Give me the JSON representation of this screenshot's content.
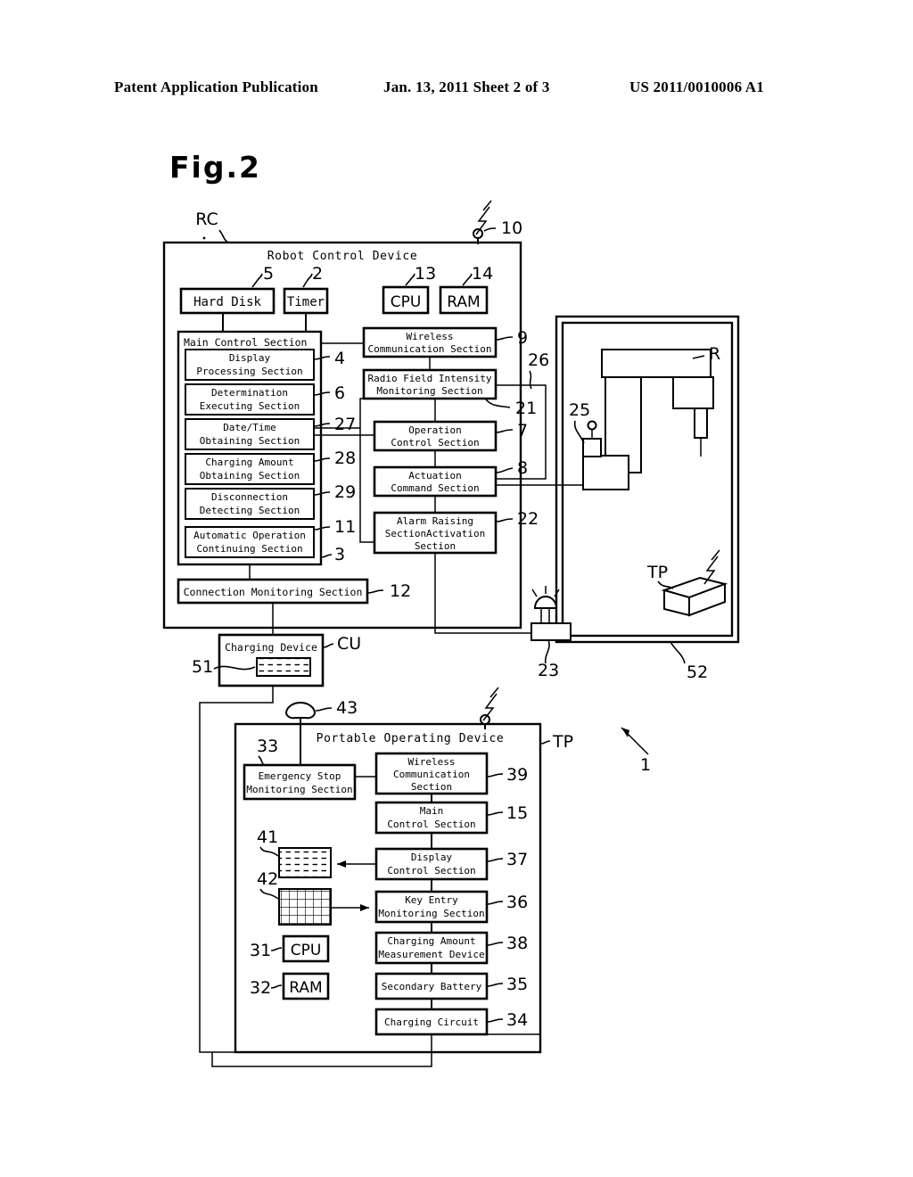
{
  "header": {
    "publication": "Patent Application Publication",
    "date_sheet": "Jan. 13, 2011  Sheet 2 of 3",
    "patent_number": "US 2011/0010006 A1"
  },
  "figure": {
    "label": "Fig.2",
    "overall_ref": "1"
  },
  "robot_control_device": {
    "title": "Robot Control Device",
    "ref": "RC",
    "antenna_ref": "10",
    "components": [
      {
        "label": "Hard Disk",
        "ref": "5"
      },
      {
        "label": "Timer",
        "ref": "2"
      },
      {
        "label": "CPU",
        "ref": "13"
      },
      {
        "label": "RAM",
        "ref": "14"
      }
    ],
    "main_control_section": {
      "label": "Main Control Section",
      "ref": "3",
      "subsections": [
        {
          "line1": "Display",
          "line2": "Processing Section",
          "ref": "4"
        },
        {
          "line1": "Determination",
          "line2": "Executing Section",
          "ref": "6"
        },
        {
          "line1": "Date/Time",
          "line2": "Obtaining Section",
          "ref": "27"
        },
        {
          "line1": "Charging Amount",
          "line2": "Obtaining Section",
          "ref": "28"
        },
        {
          "line1": "Disconnection",
          "line2": "Detecting Section",
          "ref": "29"
        },
        {
          "line1": "Automatic Operation",
          "line2": "Continuing Section",
          "ref": "11"
        }
      ]
    },
    "right_blocks": [
      {
        "line1": "Wireless",
        "line2": "Communication Section",
        "line3": "",
        "ref": "9"
      },
      {
        "line1": "Radio Field Intensity",
        "line2": "Monitoring Section",
        "line3": "",
        "ref": "21"
      },
      {
        "line1": "Operation",
        "line2": "Control Section",
        "line3": "",
        "ref": "7"
      },
      {
        "line1": "Actuation",
        "line2": "Command Section",
        "line3": "",
        "ref": "8"
      },
      {
        "line1": "Alarm Raising",
        "line2": "SectionActivation",
        "line3": "Section",
        "ref": "22"
      }
    ],
    "connection_monitoring": {
      "label": "Connection Monitoring Section",
      "ref": "12"
    },
    "bus_ref": "26"
  },
  "charging_device": {
    "label": "Charging Device",
    "ref": "CU",
    "contact_ref": "51"
  },
  "robot_cell": {
    "enclosure_ref": "52",
    "robot_ref": "R",
    "robot_base_ref": "25",
    "alarm_lamp_ref": "23",
    "teach_pendant_ref": "TP"
  },
  "portable_operating_device": {
    "title": "Portable Operating Device",
    "ref": "TP",
    "antenna_ref": "43",
    "emergency_stop": {
      "line1": "Emergency Stop",
      "line2": "Monitoring Section",
      "ref": "33"
    },
    "display_panel_ref": "41",
    "keypad_ref": "42",
    "cpu": {
      "label": "CPU",
      "ref": "31"
    },
    "ram": {
      "label": "RAM",
      "ref": "32"
    },
    "blocks": [
      {
        "line1": "Wireless",
        "line2": "Communication",
        "line3": "Section",
        "ref": "39"
      },
      {
        "line1": "Main",
        "line2": "Control Section",
        "line3": "",
        "ref": "15"
      },
      {
        "line1": "Display",
        "line2": "Control Section",
        "line3": "",
        "ref": "37"
      },
      {
        "line1": "Key Entry",
        "line2": "Monitoring Section",
        "line3": "",
        "ref": "36"
      },
      {
        "line1": "Charging Amount",
        "line2": "Measurement Device",
        "line3": "",
        "ref": "38"
      },
      {
        "line1": "Secondary Battery",
        "line2": "",
        "line3": "",
        "ref": "35"
      },
      {
        "line1": "Charging Circuit",
        "line2": "",
        "line3": "",
        "ref": "34"
      }
    ]
  },
  "colors": {
    "ink": "#000000",
    "paper": "#ffffff"
  }
}
